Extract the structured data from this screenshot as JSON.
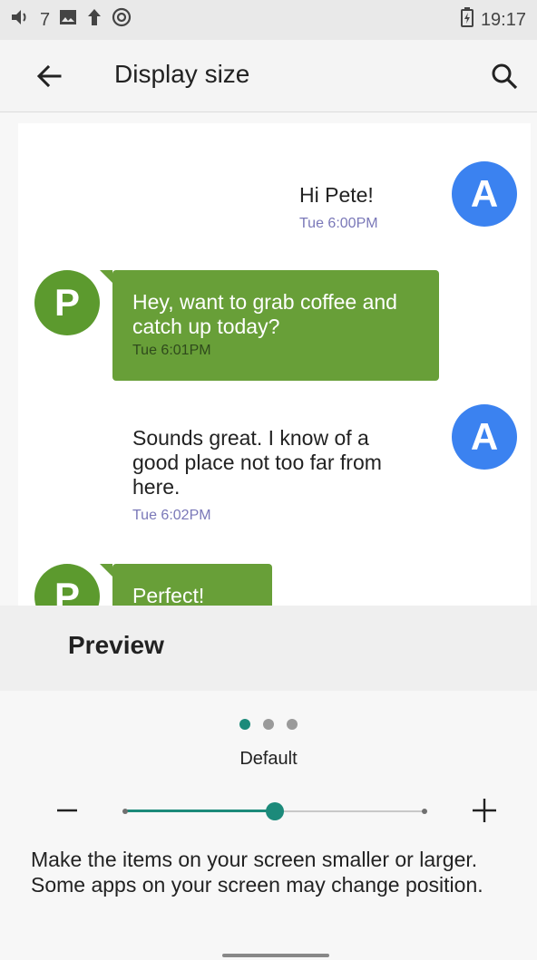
{
  "status_bar": {
    "volume_level": "7",
    "time": "19:17",
    "icons": [
      "volume-icon",
      "image-icon",
      "upload-arrow-icon",
      "sync-icon",
      "battery-charging-icon"
    ]
  },
  "app_bar": {
    "title": "Display size",
    "back_icon": "arrow-left-icon",
    "search_icon": "search-icon"
  },
  "preview": {
    "messages": [
      {
        "sender_initial": "A",
        "text": "Hi Pete!",
        "time": "Tue 6:00PM",
        "side": "right"
      },
      {
        "sender_initial": "P",
        "text": "Hey, want to grab coffee and catch up today?",
        "time": "Tue 6:01PM",
        "side": "left"
      },
      {
        "sender_initial": "A",
        "text": "Sounds great. I know of a good place not too far from here.",
        "time": "Tue 6:02PM",
        "side": "right"
      },
      {
        "sender_initial": "P",
        "text": "Perfect!",
        "time": "",
        "side": "left"
      }
    ],
    "label": "Preview"
  },
  "controls": {
    "size_label": "Default",
    "page_count": 3,
    "active_page": 0,
    "slider": {
      "steps": 3,
      "current_step": 1,
      "fraction": 0.5
    },
    "minus_label": "−",
    "plus_label": "+",
    "description": "Make the items on your screen smaller or larger. Some apps on your screen may change position.",
    "accent_color": "#1c8a7a"
  },
  "colors": {
    "avatar_a": "#3b82f0",
    "avatar_p": "#5c9a2e",
    "bubble_green": "#689f38"
  }
}
